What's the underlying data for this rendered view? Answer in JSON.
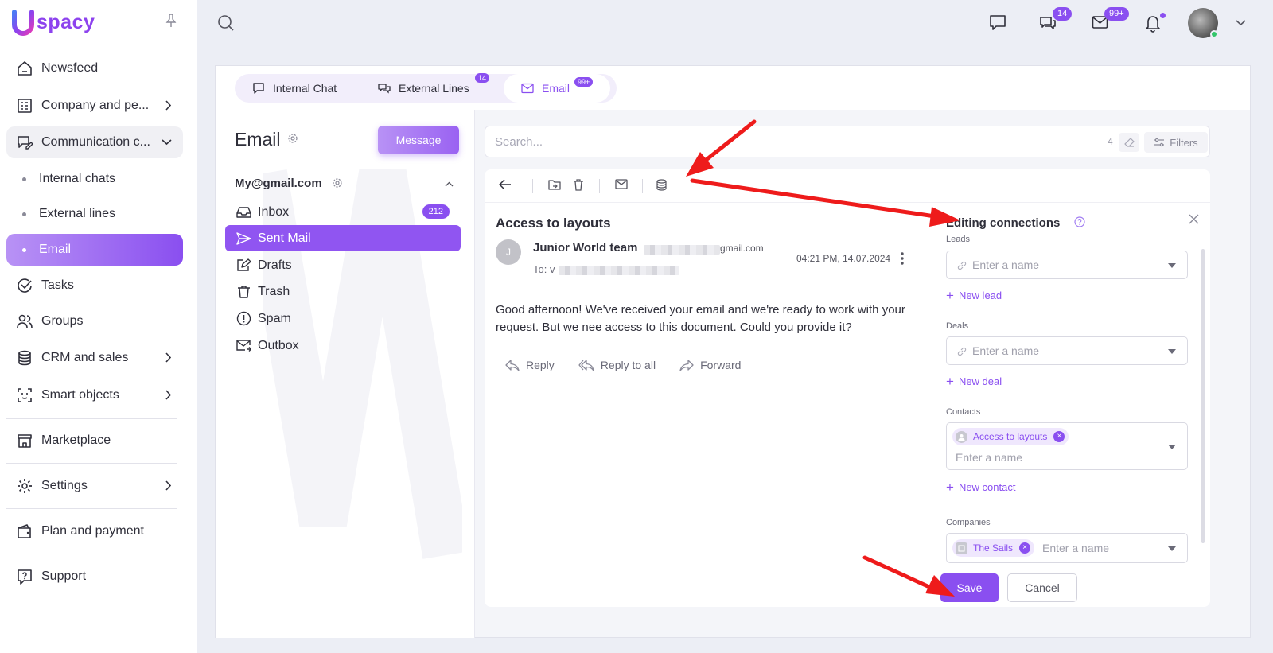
{
  "brand": {
    "name": "spacy"
  },
  "sidebar": {
    "items": [
      {
        "label": "Newsfeed"
      },
      {
        "label": "Company and pe..."
      },
      {
        "label": "Communication c..."
      },
      {
        "label": "Internal chats"
      },
      {
        "label": "External lines"
      },
      {
        "label": "Email"
      },
      {
        "label": "Tasks"
      },
      {
        "label": "Groups"
      },
      {
        "label": "CRM and sales"
      },
      {
        "label": "Smart objects"
      },
      {
        "label": "Marketplace"
      },
      {
        "label": "Settings"
      },
      {
        "label": "Plan and payment"
      },
      {
        "label": "Support"
      }
    ]
  },
  "topbar": {
    "chats_badge": "14",
    "mail_badge": "99+"
  },
  "tabs": [
    {
      "label": "Internal Chat",
      "badge": ""
    },
    {
      "label": "External Lines",
      "badge": "14"
    },
    {
      "label": "Email",
      "badge": "99+"
    }
  ],
  "mail": {
    "title": "Email",
    "message_button": "Message",
    "account": "My@gmail.com",
    "folders": [
      {
        "label": "Inbox",
        "count": "212"
      },
      {
        "label": "Sent Mail",
        "count": ""
      },
      {
        "label": "Drafts",
        "count": ""
      },
      {
        "label": "Trash",
        "count": ""
      },
      {
        "label": "Spam",
        "count": ""
      },
      {
        "label": "Outbox",
        "count": ""
      }
    ]
  },
  "search": {
    "placeholder": "Search...",
    "count": "4",
    "filters_label": "Filters"
  },
  "message": {
    "subject": "Access to layouts",
    "sender_initial": "J",
    "sender_name": "Junior World team",
    "sender_email_suffix": "gmail.com",
    "to_label": "To: v",
    "date": "04:21 PM, 14.07.2024",
    "body": "Good afternoon! We've received your email and we're ready to work with your request. But we nee access to this document. Could you provide it?",
    "actions": {
      "reply": "Reply",
      "reply_all": "Reply to all",
      "forward": "Forward"
    }
  },
  "connections": {
    "title": "Editing connections",
    "leads": {
      "label": "Leads",
      "placeholder": "Enter a name",
      "add": "New lead"
    },
    "deals": {
      "label": "Deals",
      "placeholder": "Enter a name",
      "add": "New deal"
    },
    "contacts": {
      "label": "Contacts",
      "chip": "Access to layouts",
      "placeholder": "Enter a name",
      "add": "New contact"
    },
    "companies": {
      "label": "Companies",
      "chip": "The Sails",
      "placeholder": "Enter a name"
    },
    "save_label": "Save",
    "cancel_label": "Cancel"
  },
  "colors": {
    "accent": "#8a4ff0",
    "annotation_arrow": "#ee1b1b"
  }
}
